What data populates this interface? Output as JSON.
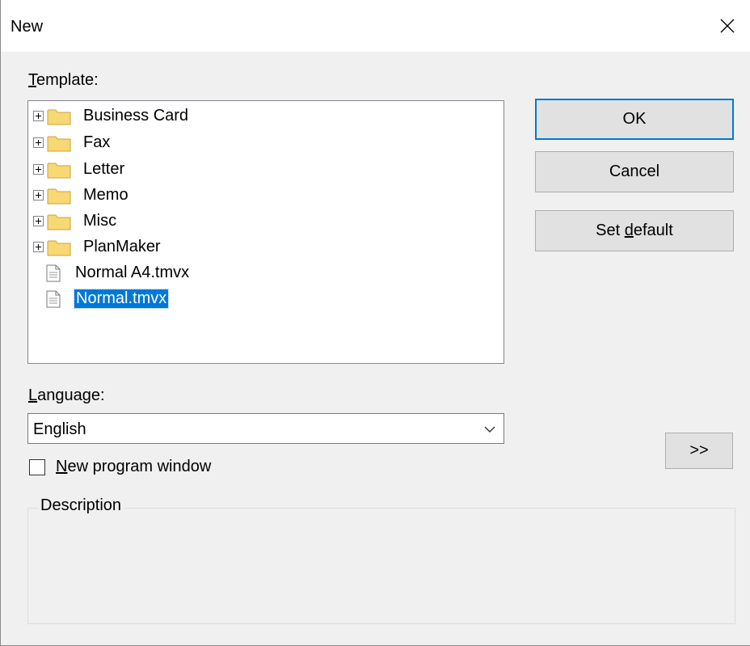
{
  "window": {
    "title": "New"
  },
  "template": {
    "label_u": "T",
    "label_rest": "emplate:",
    "items": [
      {
        "label": "Business Card",
        "type": "folder"
      },
      {
        "label": "Fax",
        "type": "folder"
      },
      {
        "label": "Letter",
        "type": "folder"
      },
      {
        "label": "Memo",
        "type": "folder"
      },
      {
        "label": "Misc",
        "type": "folder"
      },
      {
        "label": "PlanMaker",
        "type": "folder"
      },
      {
        "label": "Normal A4.tmvx",
        "type": "file"
      },
      {
        "label": "Normal.tmvx",
        "type": "file",
        "selected": true
      }
    ]
  },
  "buttons": {
    "ok": "OK",
    "cancel": "Cancel",
    "set_default_pre": "Set ",
    "set_default_u": "d",
    "set_default_post": "efault",
    "more": ">>"
  },
  "language": {
    "label_u": "L",
    "label_rest": "anguage:",
    "value": "English"
  },
  "new_window": {
    "label_u": "N",
    "label_rest": "ew program window",
    "checked": false
  },
  "description": {
    "title": "Description"
  },
  "colors": {
    "selection": "#0078d7",
    "folder": "#f8d775",
    "default_border": "#0078d7"
  }
}
